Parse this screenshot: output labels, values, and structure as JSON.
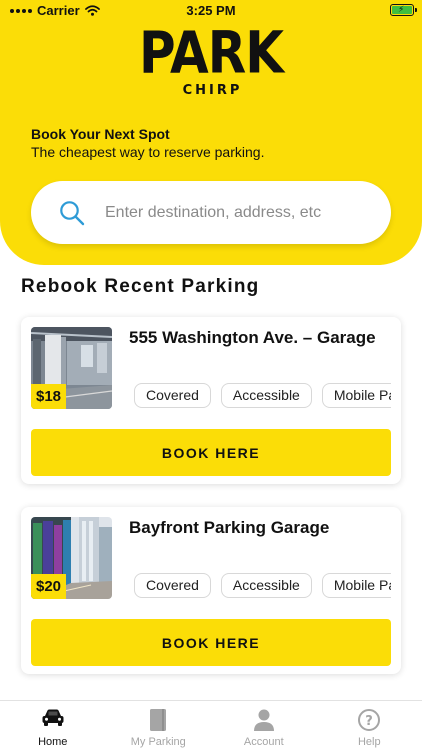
{
  "status_bar": {
    "carrier": "Carrier",
    "time": "3:25 PM"
  },
  "brand": {
    "name": "PARK",
    "sub": "CHIRP"
  },
  "tagline": {
    "title": "Book Your Next Spot",
    "subtitle": "The cheapest way to reserve parking."
  },
  "search": {
    "placeholder": "Enter destination, address, etc",
    "value": ""
  },
  "section_title": "Rebook Recent Parking",
  "cards": [
    {
      "title": "555 Washington Ave. – Garage",
      "price": "$18",
      "chips": [
        "Covered",
        "Accessible",
        "Mobile Pass"
      ],
      "button": "BOOK HERE"
    },
    {
      "title": "Bayfront Parking Garage",
      "price": "$20",
      "chips": [
        "Covered",
        "Accessible",
        "Mobile Pass"
      ],
      "button": "BOOK HERE"
    }
  ],
  "tabs": [
    {
      "label": "Home",
      "icon": "car-icon",
      "active": true
    },
    {
      "label": "My Parking",
      "icon": "book-icon",
      "active": false
    },
    {
      "label": "Account",
      "icon": "person-icon",
      "active": false
    },
    {
      "label": "Help",
      "icon": "question-icon",
      "active": false
    }
  ],
  "colors": {
    "accent": "#fbdd07",
    "search_icon": "#2e9bd6",
    "tab_inactive": "#a5a5a5"
  }
}
